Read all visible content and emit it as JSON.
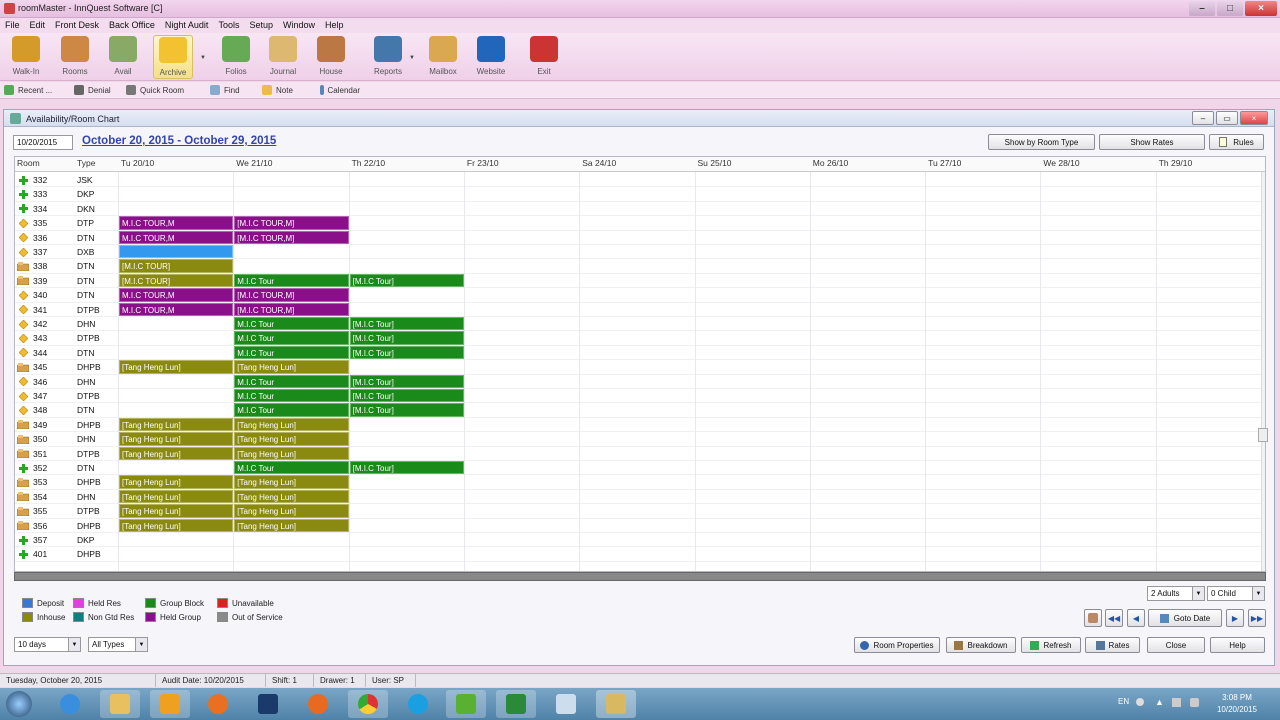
{
  "app": {
    "title": "roomMaster - InnQuest Software [C]"
  },
  "menu": [
    "File",
    "Edit",
    "Front Desk",
    "Back Office",
    "Night Audit",
    "Tools",
    "Setup",
    "Window",
    "Help"
  ],
  "toolbar": [
    {
      "label": "Walk-In",
      "icon": "walk-in-icon",
      "color": "#d49a2a"
    },
    {
      "label": "Rooms",
      "icon": "rooms-icon",
      "color": "#cc8844"
    },
    {
      "label": "Avail",
      "icon": "avail-icon",
      "color": "#88aa66"
    },
    {
      "label": "Archive",
      "icon": "archive-icon",
      "color": "#f2c230"
    },
    {
      "label": "Folios",
      "icon": "folios-icon",
      "color": "#66aa55"
    },
    {
      "label": "Journal",
      "icon": "journal-icon",
      "color": "#ddb870"
    },
    {
      "label": "House",
      "icon": "house-icon",
      "color": "#bb7744"
    },
    {
      "label": "Reports",
      "icon": "reports-icon",
      "color": "#4477aa"
    },
    {
      "label": "Mailbox",
      "icon": "mailbox-icon",
      "color": "#d9a850"
    },
    {
      "label": "Website",
      "icon": "website-icon",
      "color": "#2266bb"
    },
    {
      "label": "Exit",
      "icon": "exit-icon",
      "color": "#cc3333"
    }
  ],
  "toolbar2": [
    {
      "label": "Recent ...",
      "icon": "recent-icon",
      "color": "#55aa55"
    },
    {
      "label": "Denial",
      "icon": "denial-icon",
      "color": "#666"
    },
    {
      "label": "Quick Room",
      "icon": "quick-room-icon",
      "color": "#777"
    },
    {
      "label": "Find",
      "icon": "find-icon",
      "color": "#88aacc"
    },
    {
      "label": "Note",
      "icon": "note-icon",
      "color": "#eebb44"
    },
    {
      "label": "Calendar",
      "icon": "calendar-icon",
      "color": "#5588bb"
    }
  ],
  "window": {
    "title": "Availability/Room Chart",
    "date_value": "10/20/2015",
    "range_title": "October 20, 2015 - October 29, 2015",
    "buttons": {
      "by_type": "Show by Room Type",
      "rates": "Show Rates",
      "rules": "Rules"
    }
  },
  "columns": {
    "room": "Room",
    "type": "Type",
    "days": [
      "Tu 20/10",
      "We 21/10",
      "Th 22/10",
      "Fr 23/10",
      "Sa 24/10",
      "Su 25/10",
      "Mo 26/10",
      "Tu 27/10",
      "We 28/10",
      "Th 29/10"
    ]
  },
  "colors": {
    "deposit": "#3a78d8",
    "held_res": "#e040e0",
    "group_block": "#1a8a1a",
    "unavailable": "#dd2020",
    "inhouse": "#8a8a10",
    "non_gtd": "#0f7f7f",
    "held_group": "#8a108a",
    "out_of_service": "#8a8a8a",
    "sel_blue": "#3399ee"
  },
  "rooms": [
    {
      "num": "332",
      "type": "JSK",
      "icon": "plus"
    },
    {
      "num": "333",
      "type": "DKP",
      "icon": "plus"
    },
    {
      "num": "334",
      "type": "DKN",
      "icon": "plus"
    },
    {
      "num": "335",
      "type": "DTP",
      "icon": "diamond",
      "bars": [
        {
          "d": 0,
          "len": 1,
          "kind": "held_group",
          "text": "M.I.C TOUR,M"
        },
        {
          "d": 1,
          "len": 1,
          "kind": "held_group",
          "text": "[M.I.C TOUR,M]"
        }
      ]
    },
    {
      "num": "336",
      "type": "DTN",
      "icon": "diamond",
      "bars": [
        {
          "d": 0,
          "len": 1,
          "kind": "held_group",
          "text": "M.I.C TOUR,M"
        },
        {
          "d": 1,
          "len": 1,
          "kind": "held_group",
          "text": "[M.I.C TOUR,M]"
        }
      ]
    },
    {
      "num": "337",
      "type": "DXB",
      "icon": "diamond",
      "bars": [
        {
          "d": 0,
          "len": 1,
          "kind": "sel_blue",
          "text": ""
        }
      ]
    },
    {
      "num": "338",
      "type": "DTN",
      "icon": "bed",
      "bars": [
        {
          "d": 0,
          "len": 1,
          "kind": "inhouse",
          "text": "[M.I.C TOUR]"
        }
      ]
    },
    {
      "num": "339",
      "type": "DTN",
      "icon": "bed",
      "bars": [
        {
          "d": 0,
          "len": 1,
          "kind": "inhouse",
          "text": "[M.I.C TOUR]"
        },
        {
          "d": 1,
          "len": 1,
          "kind": "group_block",
          "text": "M.I.C Tour"
        },
        {
          "d": 2,
          "len": 1,
          "kind": "group_block",
          "text": "[M.I.C Tour]"
        }
      ]
    },
    {
      "num": "340",
      "type": "DTN",
      "icon": "diamond",
      "bars": [
        {
          "d": 0,
          "len": 1,
          "kind": "held_group",
          "text": "M.I.C TOUR,M"
        },
        {
          "d": 1,
          "len": 1,
          "kind": "held_group",
          "text": "[M.I.C TOUR,M]"
        }
      ]
    },
    {
      "num": "341",
      "type": "DTPB",
      "icon": "diamond",
      "bars": [
        {
          "d": 0,
          "len": 1,
          "kind": "held_group",
          "text": "M.I.C TOUR,M"
        },
        {
          "d": 1,
          "len": 1,
          "kind": "held_group",
          "text": "[M.I.C TOUR,M]"
        }
      ]
    },
    {
      "num": "342",
      "type": "DHN",
      "icon": "diamond",
      "bars": [
        {
          "d": 1,
          "len": 1,
          "kind": "group_block",
          "text": "M.I.C Tour"
        },
        {
          "d": 2,
          "len": 1,
          "kind": "group_block",
          "text": "[M.I.C Tour]"
        }
      ]
    },
    {
      "num": "343",
      "type": "DTPB",
      "icon": "diamond",
      "bars": [
        {
          "d": 1,
          "len": 1,
          "kind": "group_block",
          "text": "M.I.C Tour"
        },
        {
          "d": 2,
          "len": 1,
          "kind": "group_block",
          "text": "[M.I.C Tour]"
        }
      ]
    },
    {
      "num": "344",
      "type": "DTN",
      "icon": "diamond",
      "bars": [
        {
          "d": 1,
          "len": 1,
          "kind": "group_block",
          "text": "M.I.C Tour"
        },
        {
          "d": 2,
          "len": 1,
          "kind": "group_block",
          "text": "[M.I.C Tour]"
        }
      ]
    },
    {
      "num": "345",
      "type": "DHPB",
      "icon": "bed",
      "bars": [
        {
          "d": 0,
          "len": 1,
          "kind": "inhouse",
          "text": "[Tang Heng Lun]"
        },
        {
          "d": 1,
          "len": 1,
          "kind": "inhouse",
          "text": "[Tang Heng Lun]"
        }
      ]
    },
    {
      "num": "346",
      "type": "DHN",
      "icon": "diamond",
      "bars": [
        {
          "d": 1,
          "len": 1,
          "kind": "group_block",
          "text": "M.I.C Tour"
        },
        {
          "d": 2,
          "len": 1,
          "kind": "group_block",
          "text": "[M.I.C Tour]"
        }
      ]
    },
    {
      "num": "347",
      "type": "DTPB",
      "icon": "diamond",
      "bars": [
        {
          "d": 1,
          "len": 1,
          "kind": "group_block",
          "text": "M.I.C Tour"
        },
        {
          "d": 2,
          "len": 1,
          "kind": "group_block",
          "text": "[M.I.C Tour]"
        }
      ]
    },
    {
      "num": "348",
      "type": "DTN",
      "icon": "diamond",
      "bars": [
        {
          "d": 1,
          "len": 1,
          "kind": "group_block",
          "text": "M.I.C Tour"
        },
        {
          "d": 2,
          "len": 1,
          "kind": "group_block",
          "text": "[M.I.C Tour]"
        }
      ]
    },
    {
      "num": "349",
      "type": "DHPB",
      "icon": "bed",
      "bars": [
        {
          "d": 0,
          "len": 1,
          "kind": "inhouse",
          "text": "[Tang Heng Lun]"
        },
        {
          "d": 1,
          "len": 1,
          "kind": "inhouse",
          "text": "[Tang Heng Lun]"
        }
      ]
    },
    {
      "num": "350",
      "type": "DHN",
      "icon": "bed",
      "bars": [
        {
          "d": 0,
          "len": 1,
          "kind": "inhouse",
          "text": "[Tang Heng Lun]"
        },
        {
          "d": 1,
          "len": 1,
          "kind": "inhouse",
          "text": "[Tang Heng Lun]"
        }
      ]
    },
    {
      "num": "351",
      "type": "DTPB",
      "icon": "bed",
      "bars": [
        {
          "d": 0,
          "len": 1,
          "kind": "inhouse",
          "text": "[Tang Heng Lun]"
        },
        {
          "d": 1,
          "len": 1,
          "kind": "inhouse",
          "text": "[Tang Heng Lun]"
        }
      ]
    },
    {
      "num": "352",
      "type": "DTN",
      "icon": "plus",
      "bars": [
        {
          "d": 1,
          "len": 1,
          "kind": "group_block",
          "text": "M.I.C Tour"
        },
        {
          "d": 2,
          "len": 1,
          "kind": "group_block",
          "text": "[M.I.C Tour]"
        }
      ]
    },
    {
      "num": "353",
      "type": "DHPB",
      "icon": "bed",
      "bars": [
        {
          "d": 0,
          "len": 1,
          "kind": "inhouse",
          "text": "[Tang Heng Lun]"
        },
        {
          "d": 1,
          "len": 1,
          "kind": "inhouse",
          "text": "[Tang Heng Lun]"
        }
      ]
    },
    {
      "num": "354",
      "type": "DHN",
      "icon": "bed",
      "bars": [
        {
          "d": 0,
          "len": 1,
          "kind": "inhouse",
          "text": "[Tang Heng Lun]"
        },
        {
          "d": 1,
          "len": 1,
          "kind": "inhouse",
          "text": "[Tang Heng Lun]"
        }
      ]
    },
    {
      "num": "355",
      "type": "DTPB",
      "icon": "bed",
      "bars": [
        {
          "d": 0,
          "len": 1,
          "kind": "inhouse",
          "text": "[Tang Heng Lun]"
        },
        {
          "d": 1,
          "len": 1,
          "kind": "inhouse",
          "text": "[Tang Heng Lun]"
        }
      ]
    },
    {
      "num": "356",
      "type": "DHPB",
      "icon": "bed",
      "bars": [
        {
          "d": 0,
          "len": 1,
          "kind": "inhouse",
          "text": "[Tang Heng Lun]"
        },
        {
          "d": 1,
          "len": 1,
          "kind": "inhouse",
          "text": "[Tang Heng Lun]"
        }
      ]
    },
    {
      "num": "357",
      "type": "DKP",
      "icon": "plus"
    },
    {
      "num": "401",
      "type": "DHPB",
      "icon": "plus"
    }
  ],
  "legend": [
    {
      "label": "Deposit",
      "key": "deposit"
    },
    {
      "label": "Held Res",
      "key": "held_res"
    },
    {
      "label": "Group Block",
      "key": "group_block"
    },
    {
      "label": "Unavailable",
      "key": "unavailable"
    },
    {
      "label": "Inhouse",
      "key": "inhouse"
    },
    {
      "label": "Non Gtd Res",
      "key": "non_gtd"
    },
    {
      "label": "Held Group",
      "key": "held_group"
    },
    {
      "label": "Out of Service",
      "key": "out_of_service"
    }
  ],
  "filters": {
    "days": "10 days",
    "types": "All Types",
    "adults": "2 Adults",
    "child": "0 Child"
  },
  "nav": {
    "goto": "Goto Date"
  },
  "actions": {
    "room_properties": "Room Properties",
    "breakdown": "Breakdown",
    "refresh": "Refresh",
    "rates": "Rates",
    "close": "Close",
    "help": "Help"
  },
  "status": [
    "Tuesday, October 20, 2015",
    "Audit Date: 10/20/2015",
    "Shift: 1",
    "Drawer: 1",
    "User: SP"
  ],
  "taskbar": {
    "lang": "EN",
    "time": "3:08 PM",
    "date": "10/20/2015"
  }
}
